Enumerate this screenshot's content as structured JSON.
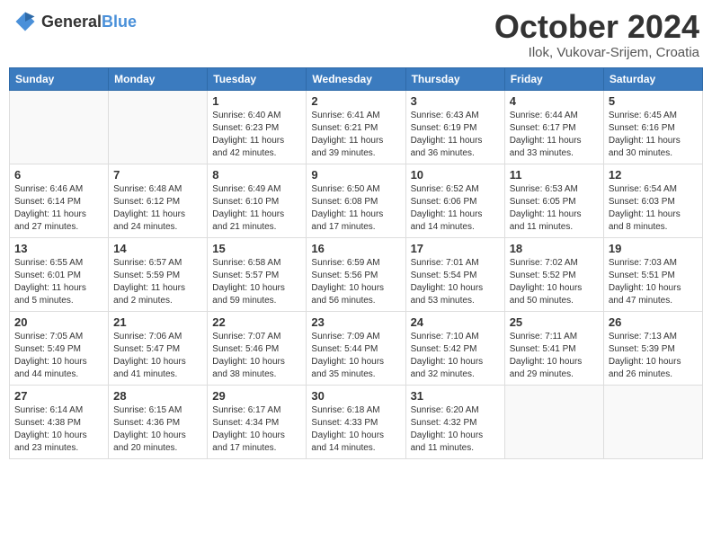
{
  "header": {
    "logo_general": "General",
    "logo_blue": "Blue",
    "month": "October 2024",
    "location": "Ilok, Vukovar-Srijem, Croatia"
  },
  "days_of_week": [
    "Sunday",
    "Monday",
    "Tuesday",
    "Wednesday",
    "Thursday",
    "Friday",
    "Saturday"
  ],
  "weeks": [
    [
      {
        "day": "",
        "info": ""
      },
      {
        "day": "",
        "info": ""
      },
      {
        "day": "1",
        "info": "Sunrise: 6:40 AM\nSunset: 6:23 PM\nDaylight: 11 hours and 42 minutes."
      },
      {
        "day": "2",
        "info": "Sunrise: 6:41 AM\nSunset: 6:21 PM\nDaylight: 11 hours and 39 minutes."
      },
      {
        "day": "3",
        "info": "Sunrise: 6:43 AM\nSunset: 6:19 PM\nDaylight: 11 hours and 36 minutes."
      },
      {
        "day": "4",
        "info": "Sunrise: 6:44 AM\nSunset: 6:17 PM\nDaylight: 11 hours and 33 minutes."
      },
      {
        "day": "5",
        "info": "Sunrise: 6:45 AM\nSunset: 6:16 PM\nDaylight: 11 hours and 30 minutes."
      }
    ],
    [
      {
        "day": "6",
        "info": "Sunrise: 6:46 AM\nSunset: 6:14 PM\nDaylight: 11 hours and 27 minutes."
      },
      {
        "day": "7",
        "info": "Sunrise: 6:48 AM\nSunset: 6:12 PM\nDaylight: 11 hours and 24 minutes."
      },
      {
        "day": "8",
        "info": "Sunrise: 6:49 AM\nSunset: 6:10 PM\nDaylight: 11 hours and 21 minutes."
      },
      {
        "day": "9",
        "info": "Sunrise: 6:50 AM\nSunset: 6:08 PM\nDaylight: 11 hours and 17 minutes."
      },
      {
        "day": "10",
        "info": "Sunrise: 6:52 AM\nSunset: 6:06 PM\nDaylight: 11 hours and 14 minutes."
      },
      {
        "day": "11",
        "info": "Sunrise: 6:53 AM\nSunset: 6:05 PM\nDaylight: 11 hours and 11 minutes."
      },
      {
        "day": "12",
        "info": "Sunrise: 6:54 AM\nSunset: 6:03 PM\nDaylight: 11 hours and 8 minutes."
      }
    ],
    [
      {
        "day": "13",
        "info": "Sunrise: 6:55 AM\nSunset: 6:01 PM\nDaylight: 11 hours and 5 minutes."
      },
      {
        "day": "14",
        "info": "Sunrise: 6:57 AM\nSunset: 5:59 PM\nDaylight: 11 hours and 2 minutes."
      },
      {
        "day": "15",
        "info": "Sunrise: 6:58 AM\nSunset: 5:57 PM\nDaylight: 10 hours and 59 minutes."
      },
      {
        "day": "16",
        "info": "Sunrise: 6:59 AM\nSunset: 5:56 PM\nDaylight: 10 hours and 56 minutes."
      },
      {
        "day": "17",
        "info": "Sunrise: 7:01 AM\nSunset: 5:54 PM\nDaylight: 10 hours and 53 minutes."
      },
      {
        "day": "18",
        "info": "Sunrise: 7:02 AM\nSunset: 5:52 PM\nDaylight: 10 hours and 50 minutes."
      },
      {
        "day": "19",
        "info": "Sunrise: 7:03 AM\nSunset: 5:51 PM\nDaylight: 10 hours and 47 minutes."
      }
    ],
    [
      {
        "day": "20",
        "info": "Sunrise: 7:05 AM\nSunset: 5:49 PM\nDaylight: 10 hours and 44 minutes."
      },
      {
        "day": "21",
        "info": "Sunrise: 7:06 AM\nSunset: 5:47 PM\nDaylight: 10 hours and 41 minutes."
      },
      {
        "day": "22",
        "info": "Sunrise: 7:07 AM\nSunset: 5:46 PM\nDaylight: 10 hours and 38 minutes."
      },
      {
        "day": "23",
        "info": "Sunrise: 7:09 AM\nSunset: 5:44 PM\nDaylight: 10 hours and 35 minutes."
      },
      {
        "day": "24",
        "info": "Sunrise: 7:10 AM\nSunset: 5:42 PM\nDaylight: 10 hours and 32 minutes."
      },
      {
        "day": "25",
        "info": "Sunrise: 7:11 AM\nSunset: 5:41 PM\nDaylight: 10 hours and 29 minutes."
      },
      {
        "day": "26",
        "info": "Sunrise: 7:13 AM\nSunset: 5:39 PM\nDaylight: 10 hours and 26 minutes."
      }
    ],
    [
      {
        "day": "27",
        "info": "Sunrise: 6:14 AM\nSunset: 4:38 PM\nDaylight: 10 hours and 23 minutes."
      },
      {
        "day": "28",
        "info": "Sunrise: 6:15 AM\nSunset: 4:36 PM\nDaylight: 10 hours and 20 minutes."
      },
      {
        "day": "29",
        "info": "Sunrise: 6:17 AM\nSunset: 4:34 PM\nDaylight: 10 hours and 17 minutes."
      },
      {
        "day": "30",
        "info": "Sunrise: 6:18 AM\nSunset: 4:33 PM\nDaylight: 10 hours and 14 minutes."
      },
      {
        "day": "31",
        "info": "Sunrise: 6:20 AM\nSunset: 4:32 PM\nDaylight: 10 hours and 11 minutes."
      },
      {
        "day": "",
        "info": ""
      },
      {
        "day": "",
        "info": ""
      }
    ]
  ]
}
